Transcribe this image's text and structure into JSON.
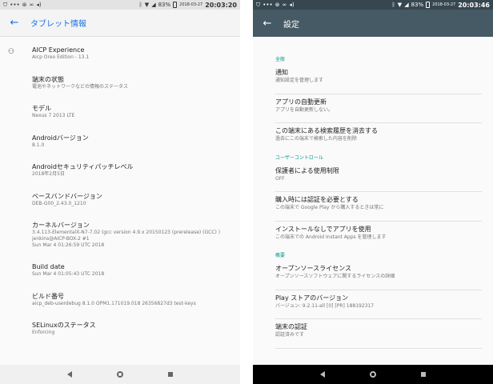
{
  "left": {
    "status": {
      "battery": "83%",
      "date": "2018-03-27",
      "time": "20:03:20"
    },
    "toolbar": {
      "title": "タブレット情報"
    },
    "items": [
      {
        "title": "AICP Experience",
        "summary": "Aicp Oreo Edition - 13.1"
      },
      {
        "title": "端末の状態",
        "summary": "電池やネットワークなどの情報のステータス"
      },
      {
        "title": "モデル",
        "summary": "Nexus 7 2013 LTE"
      },
      {
        "title": "Androidバージョン",
        "summary": "8.1.0"
      },
      {
        "title": "Androidセキュリティパッチレベル",
        "summary": "2018年2月5日"
      },
      {
        "title": "ベースバンドバージョン",
        "summary": "DEB-G00_2.43.0_1210"
      },
      {
        "title": "カーネルバージョン",
        "summary1": "3.4.113-ElementalX-N7-7.02 (gcc version 4.9.x 20150123 (prerelease) (GCC) )",
        "summary2": "jenkins@AICP-BOX-2 #1",
        "summary3": "Sun Mar 4 01:26:59 UTC 2018"
      },
      {
        "title": "Build date",
        "summary": "Sun Mar  4 01:05:43 UTC 2018"
      },
      {
        "title": "ビルド番号",
        "summary": "aicp_deb-userdebug 8.1.0 OPM1.171019.018 26356827d3 test-keys"
      },
      {
        "title": "SELinuxのステータス",
        "summary": "Enforcing"
      }
    ]
  },
  "right": {
    "status": {
      "battery": "83%",
      "date": "2018-03-27",
      "time": "20:03:46"
    },
    "toolbar": {
      "title": "設定"
    },
    "cat_general": "全般",
    "cat_user": "ユーザーコントロール",
    "cat_about": "概要",
    "general": [
      {
        "title": "通知",
        "summary": "通知設定を管理します"
      },
      {
        "title": "アプリの自動更新",
        "summary": "アプリを自動更新しない。"
      },
      {
        "title": "この端末にある検索履歴を消去する",
        "summary": "過去にこの端末で検索した内容を削除"
      }
    ],
    "user": [
      {
        "title": "保護者による使用制限",
        "summary": "OFF"
      },
      {
        "title": "購入時には認証を必要とする",
        "summary": "この端末で Google Play から購入するときは常に"
      },
      {
        "title": "インストールなしでアプリを使用",
        "summary": "この端末での Android Instant Apps を管理します"
      }
    ],
    "about": [
      {
        "title": "オープンソースライセンス",
        "summary": "オープンソースソフトウェアに関するライセンスの詳細"
      },
      {
        "title": "Play ストアのバージョン",
        "summary": "バージョン: 9.2.11-all [0] [PR] 188192317"
      },
      {
        "title": "端末の認証",
        "summary": "認証済みです"
      }
    ]
  }
}
